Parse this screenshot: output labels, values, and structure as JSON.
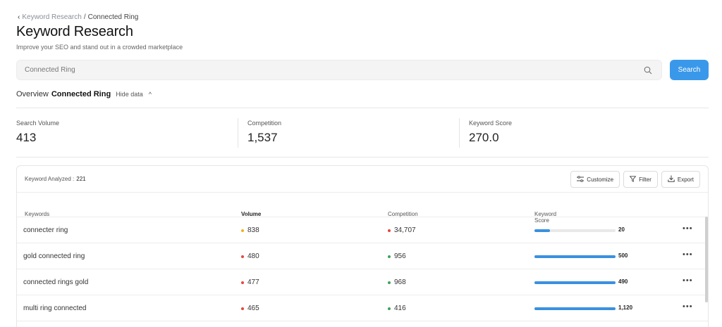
{
  "breadcrumb": {
    "parent": "Keyword Research",
    "separator": "/",
    "current": "Connected Ring"
  },
  "header": {
    "title": "Keyword Research",
    "subtitle": "Improve your SEO and stand out in a crowded marketplace"
  },
  "search": {
    "value": "Connected Ring",
    "button_label": "Search"
  },
  "overview": {
    "label": "Overview",
    "keyword": "Connected Ring",
    "toggle_label": "Hide data"
  },
  "stats": [
    {
      "label": "Search Volume",
      "value": "413"
    },
    {
      "label": "Competition",
      "value": "1,537"
    },
    {
      "label": "Keyword Score",
      "value": "270.0"
    }
  ],
  "table": {
    "analyzed_label": "Keyword Analyzed :",
    "analyzed_count": "221",
    "toolbar": {
      "customize": "Customize",
      "filter": "Filter",
      "export": "Export"
    },
    "columns": [
      "Keywords",
      "Volume",
      "Competition",
      "Keyword Score"
    ],
    "rows": [
      {
        "keyword": "connecter ring",
        "volume": "838",
        "volume_color": "#f2b01e",
        "competition": "34,707",
        "competition_color": "#e5483c",
        "score": "20",
        "score_pct": 0.19
      },
      {
        "keyword": "gold connected ring",
        "volume": "480",
        "volume_color": "#e5483c",
        "competition": "956",
        "competition_color": "#3aa55a",
        "score": "500",
        "score_pct": 1.0
      },
      {
        "keyword": "connected rings gold",
        "volume": "477",
        "volume_color": "#e5483c",
        "competition": "968",
        "competition_color": "#3aa55a",
        "score": "490",
        "score_pct": 1.0
      },
      {
        "keyword": "multi ring connected",
        "volume": "465",
        "volume_color": "#e5483c",
        "competition": "416",
        "competition_color": "#3aa55a",
        "score": "1,120",
        "score_pct": 1.0
      }
    ]
  },
  "colors": {
    "accent": "#3a98ea"
  }
}
